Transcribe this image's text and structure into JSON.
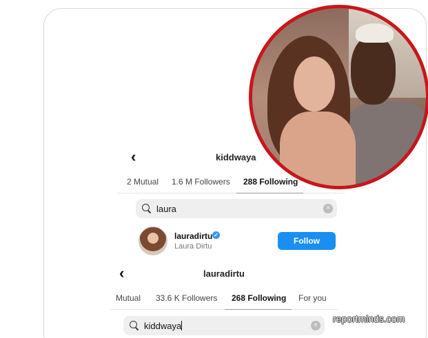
{
  "profile_top": {
    "title": "kiddwaya",
    "tabs": [
      {
        "label": "2 Mutual"
      },
      {
        "label": "1.6 M Followers"
      },
      {
        "label": "288 Following"
      }
    ],
    "search_value": "laura",
    "result": {
      "username": "lauradirtu",
      "full_name": "Laura Dirtu",
      "button_label": "Follow"
    }
  },
  "profile_bottom": {
    "title": "lauradirtu",
    "tabs": [
      {
        "label": "Mutual"
      },
      {
        "label": "33.6 K Followers"
      },
      {
        "label": "268 Following"
      },
      {
        "label": "For you"
      }
    ],
    "search_value": "kiddwaya"
  },
  "watermark": "reportminds.com",
  "colors": {
    "accent": "#1a8ff2",
    "verified": "#3897f0",
    "photo_ring": "#c7161c"
  },
  "icons": {
    "back": "chevron-left-icon",
    "search": "magnifier-icon",
    "clear": "clear-circle-icon",
    "verified": "verified-badge-icon"
  }
}
